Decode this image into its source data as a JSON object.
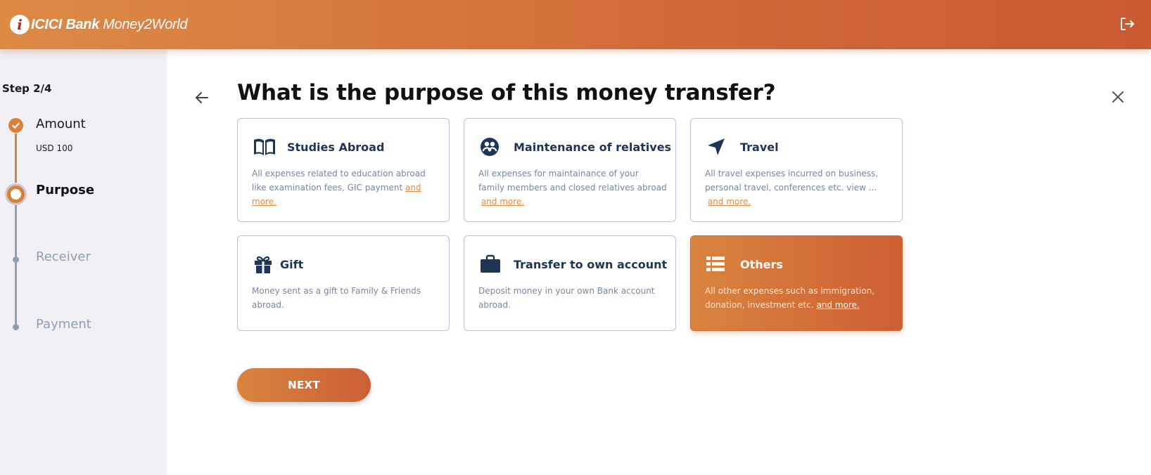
{
  "header": {
    "brand_bold": "ICICI Bank",
    "brand_rest": " Money2World",
    "logo_letter": "i",
    "logout_icon": "logout-icon"
  },
  "sidebar": {
    "step_count": "Step 2/4",
    "steps": [
      {
        "label": "Amount",
        "sub": "USD 100",
        "state": "done"
      },
      {
        "label": "Purpose",
        "state": "current"
      },
      {
        "label": "Receiver",
        "state": "upcoming"
      },
      {
        "label": "Payment",
        "state": "upcoming"
      }
    ]
  },
  "main": {
    "title": "What is the purpose of this money transfer?",
    "cards": [
      {
        "title": "Studies Abroad",
        "desc": "All expenses related to education abroad like examination fees, GIC payment ",
        "more": "and more.",
        "icon": "book-icon",
        "selected": false
      },
      {
        "title": "Maintenance of relatives",
        "desc": "All expenses for maintainance of your family members and closed relatives abroad",
        "more": "and more.",
        "icon": "family-icon",
        "selected": false
      },
      {
        "title": "Travel",
        "desc": "All travel expenses incurred on business, personal travel, conferences etc. view ...",
        "more": "and more.",
        "icon": "navigation-icon",
        "selected": false
      },
      {
        "title": "Gift",
        "desc": "Money sent as a gift to Family & Friends abroad.",
        "icon": "gift-icon",
        "selected": false
      },
      {
        "title": "Transfer to own account",
        "desc": "Deposit money in your own Bank account abroad.",
        "icon": "briefcase-icon",
        "selected": false
      },
      {
        "title": "Others",
        "desc": "All other expenses such as immigration, donation, investment etc. ",
        "more": "and more.",
        "icon": "list-icon",
        "selected": true
      }
    ],
    "next_label": "NEXT"
  },
  "colors": {
    "accent": "#d9813b",
    "accent_dark": "#cc5f34",
    "title_blue": "#1e3556",
    "desc_gray": "#7787a3",
    "sidebar_bg": "#f0f0f5"
  }
}
